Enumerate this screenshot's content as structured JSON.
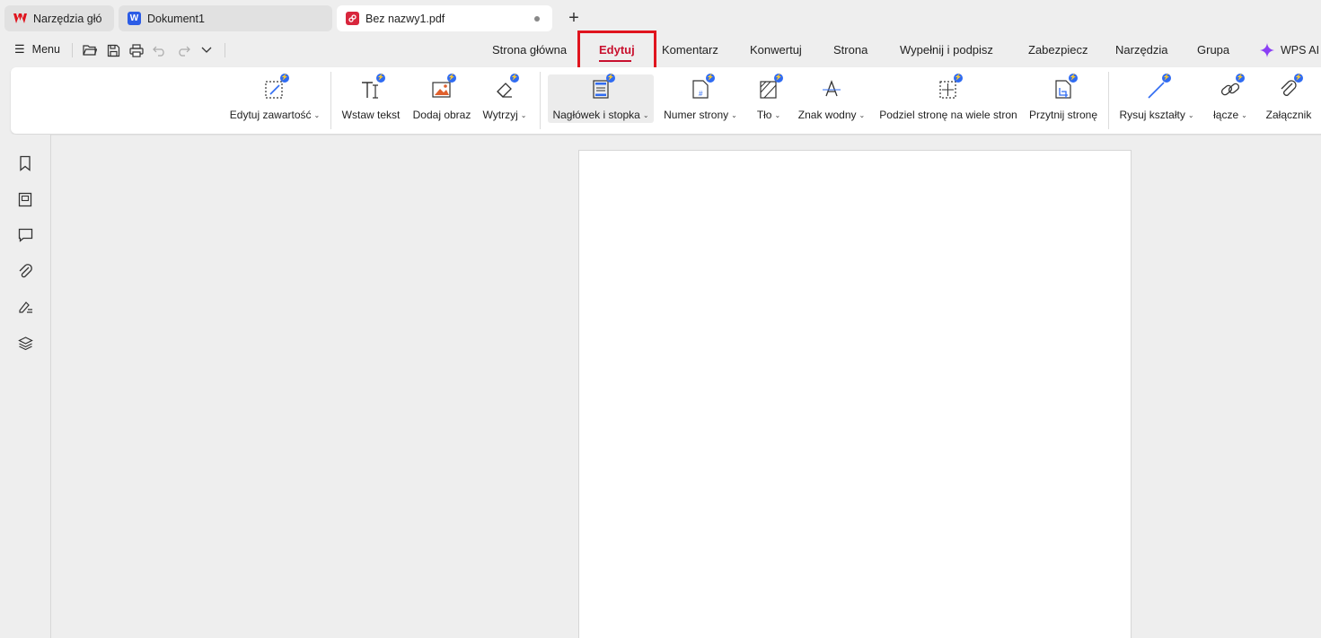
{
  "tabs": [
    {
      "label": "Narzędzia głó",
      "icon": "wps-logo-icon"
    },
    {
      "label": "Dokument1",
      "icon": "word-doc-icon"
    },
    {
      "label": "Bez nazwy1.pdf",
      "icon": "pdf-doc-icon"
    }
  ],
  "menu": {
    "label": "Menu"
  },
  "ribbon_tabs": [
    {
      "label": "Strona główna"
    },
    {
      "label": "Edytuj"
    },
    {
      "label": "Komentarz"
    },
    {
      "label": "Konwertuj"
    },
    {
      "label": "Strona"
    },
    {
      "label": "Wypełnij i podpisz"
    },
    {
      "label": "Zabezpiecz"
    },
    {
      "label": "Narzędzia"
    },
    {
      "label": "Grupa"
    }
  ],
  "active_tab": "Edytuj",
  "wps_ai": {
    "label": "WPS AI"
  },
  "tools": [
    {
      "label": "Edytuj zawartość",
      "icon": "edit-content-icon",
      "dropdown": true
    },
    {
      "label": "Wstaw tekst",
      "icon": "insert-text-icon",
      "dropdown": false
    },
    {
      "label": "Dodaj obraz",
      "icon": "add-image-icon",
      "dropdown": false
    },
    {
      "label": "Wytrzyj",
      "icon": "eraser-icon",
      "dropdown": true
    },
    {
      "label": "Nagłówek i stopka",
      "icon": "header-footer-icon",
      "dropdown": true
    },
    {
      "label": "Numer strony",
      "icon": "page-number-icon",
      "dropdown": true
    },
    {
      "label": "Tło",
      "icon": "background-icon",
      "dropdown": true
    },
    {
      "label": "Znak wodny",
      "icon": "watermark-icon",
      "dropdown": true
    },
    {
      "label": "Podziel stronę na wiele stron",
      "icon": "split-page-icon",
      "dropdown": false
    },
    {
      "label": "Przytnij stronę",
      "icon": "crop-page-icon",
      "dropdown": false
    },
    {
      "label": "Rysuj kształty",
      "icon": "draw-shapes-icon",
      "dropdown": true
    },
    {
      "label": "łącze",
      "icon": "link-icon",
      "dropdown": true
    },
    {
      "label": "Załącznik",
      "icon": "attachment-icon",
      "dropdown": false
    }
  ],
  "colors": {
    "accent": "#c8102e",
    "highlight": "#e0141e",
    "badge": "#2f6bf2"
  }
}
